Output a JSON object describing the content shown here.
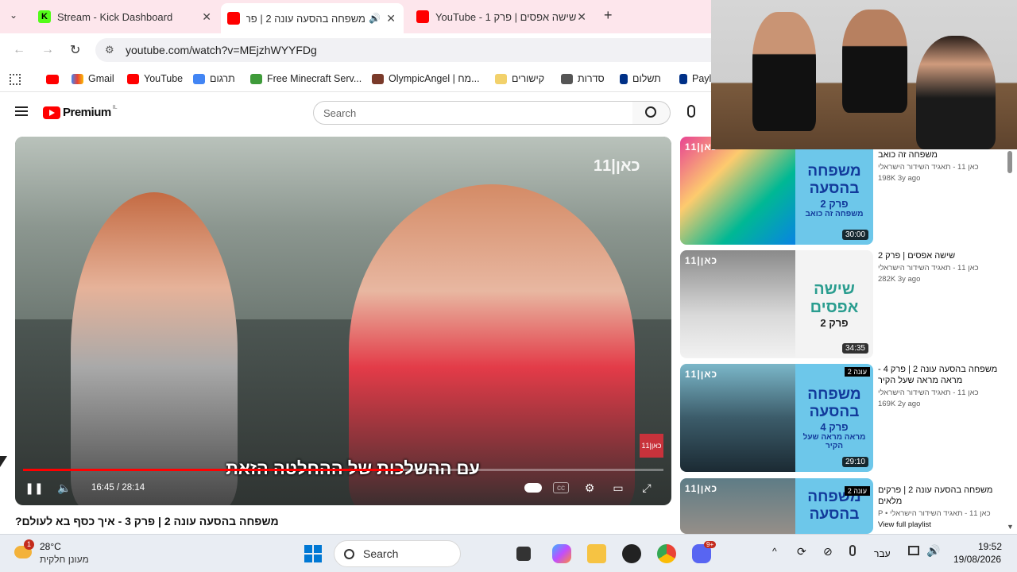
{
  "browser": {
    "tabs": [
      {
        "title": "Stream - Kick Dashboard"
      },
      {
        "title": "משפחה בהסעה עונה 2 | פר"
      },
      {
        "title": "YouTube - שישה אפסים | פרק 1"
      }
    ],
    "url": "youtube.com/watch?v=MEjzhWYYFDg",
    "bookmarks": [
      "Gmail",
      "YouTube",
      "תרגום",
      "Free Minecraft Serv...",
      "OlympicAngel | מח...",
      "קישורים",
      "סדרות",
      "תשלום",
      "Payl"
    ]
  },
  "youtube": {
    "logo_text": "Premium",
    "logo_region": "IL",
    "search_placeholder": "Search"
  },
  "player": {
    "subtitle": "עם ההשלכות של ההחלטה הזאת",
    "current_time": "16:45",
    "duration": "28:14",
    "time_display": "16:45 / 28:14",
    "progress": 0.593,
    "watermark": "כאן|11"
  },
  "video_title": "משפחה בהסעה עונה 2 | פרק 3 - איך כסף בא לעולם?",
  "recommendations": [
    {
      "title": "משפחה זה כואב",
      "channel": "כאן 11 - תאגיד השידור הישראלי",
      "stats": "198K  3y ago",
      "duration": "30:00",
      "thumb_line1": "משפחה",
      "thumb_line2": "בהסעה",
      "thumb_line3": "פרק 2",
      "thumb_line4": "משפחה זה כואב"
    },
    {
      "title": "שישה אפסים | פרק 2",
      "channel": "כאן 11 - תאגיד השידור הישראלי",
      "stats": "282K  3y ago",
      "duration": "34:35",
      "thumb_line1": "שישה",
      "thumb_line2": "אפסים",
      "thumb_line3": "פרק 2",
      "thumb_line4": ""
    },
    {
      "title": "משפחה בהסעה עונה 2 | פרק 4 - מראה מראה שעל הקיר",
      "channel": "כאן 11 - תאגיד השידור הישראלי",
      "stats": "169K  2y ago",
      "duration": "29:10",
      "thumb_line1": "משפחה",
      "thumb_line2": "בהסעה",
      "thumb_line3": "פרק 4",
      "thumb_line4": "מראה מראה שעל הקיר",
      "badge": "עונה 2"
    },
    {
      "title": "משפחה בהסעה עונה 2 | פרקים מלאים",
      "channel": "כאן 11 - תאגיד השידור הישראלי • P",
      "stats": "View full playlist",
      "duration": "",
      "thumb_line1": "משפחה",
      "thumb_line2": "בהסעה",
      "thumb_line3": "",
      "thumb_line4": "",
      "badge": "עונה 2"
    }
  ],
  "taskbar": {
    "weather_temp": "28°C",
    "weather_desc": "מעונן חלקית",
    "weather_badge": "1",
    "search_label": "Search",
    "lang": "עבר",
    "time": "19:52",
    "date": "19/08/2026",
    "discord_badge": "9+"
  },
  "colors": {
    "youtube_red": "#ff0000",
    "tabbar": "#fde6ec",
    "thumb_blue": "#6dc7ea"
  }
}
